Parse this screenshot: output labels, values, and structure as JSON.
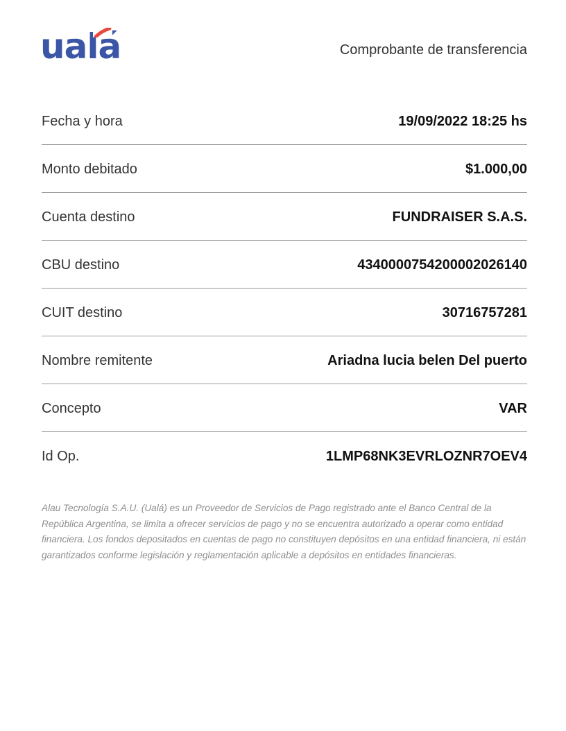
{
  "brand": {
    "logo_text": "ualá",
    "logo_color": "#3b56a6",
    "accent_color": "#e8483f"
  },
  "header": {
    "title": "Comprobante de transferencia"
  },
  "details": [
    {
      "label": "Fecha y hora",
      "value": "19/09/2022 18:25 hs"
    },
    {
      "label": "Monto debitado",
      "value": "$1.000,00"
    },
    {
      "label": "Cuenta destino",
      "value": "FUNDRAISER S.A.S."
    },
    {
      "label": "CBU destino",
      "value": "4340000754200002026140"
    },
    {
      "label": "CUIT destino",
      "value": "30716757281"
    },
    {
      "label": "Nombre remitente",
      "value": "Ariadna lucia belen Del puerto"
    },
    {
      "label": "Concepto",
      "value": "VAR"
    },
    {
      "label": "Id Op.",
      "value": "1LMP68NK3EVRLOZNR7OEV4"
    }
  ],
  "disclaimer": "Alau Tecnología S.A.U. (Ualá) es un Proveedor de Servicios de Pago registrado ante el Banco Central de la República Argentina, se limita a ofrecer servicios de pago y no se encuentra autorizado a operar como entidad financiera. Los fondos depositados en cuentas de pago no constituyen depósitos en una entidad financiera, ni están garantizados conforme legislación y reglamentación aplicable a depósitos en entidades financieras."
}
